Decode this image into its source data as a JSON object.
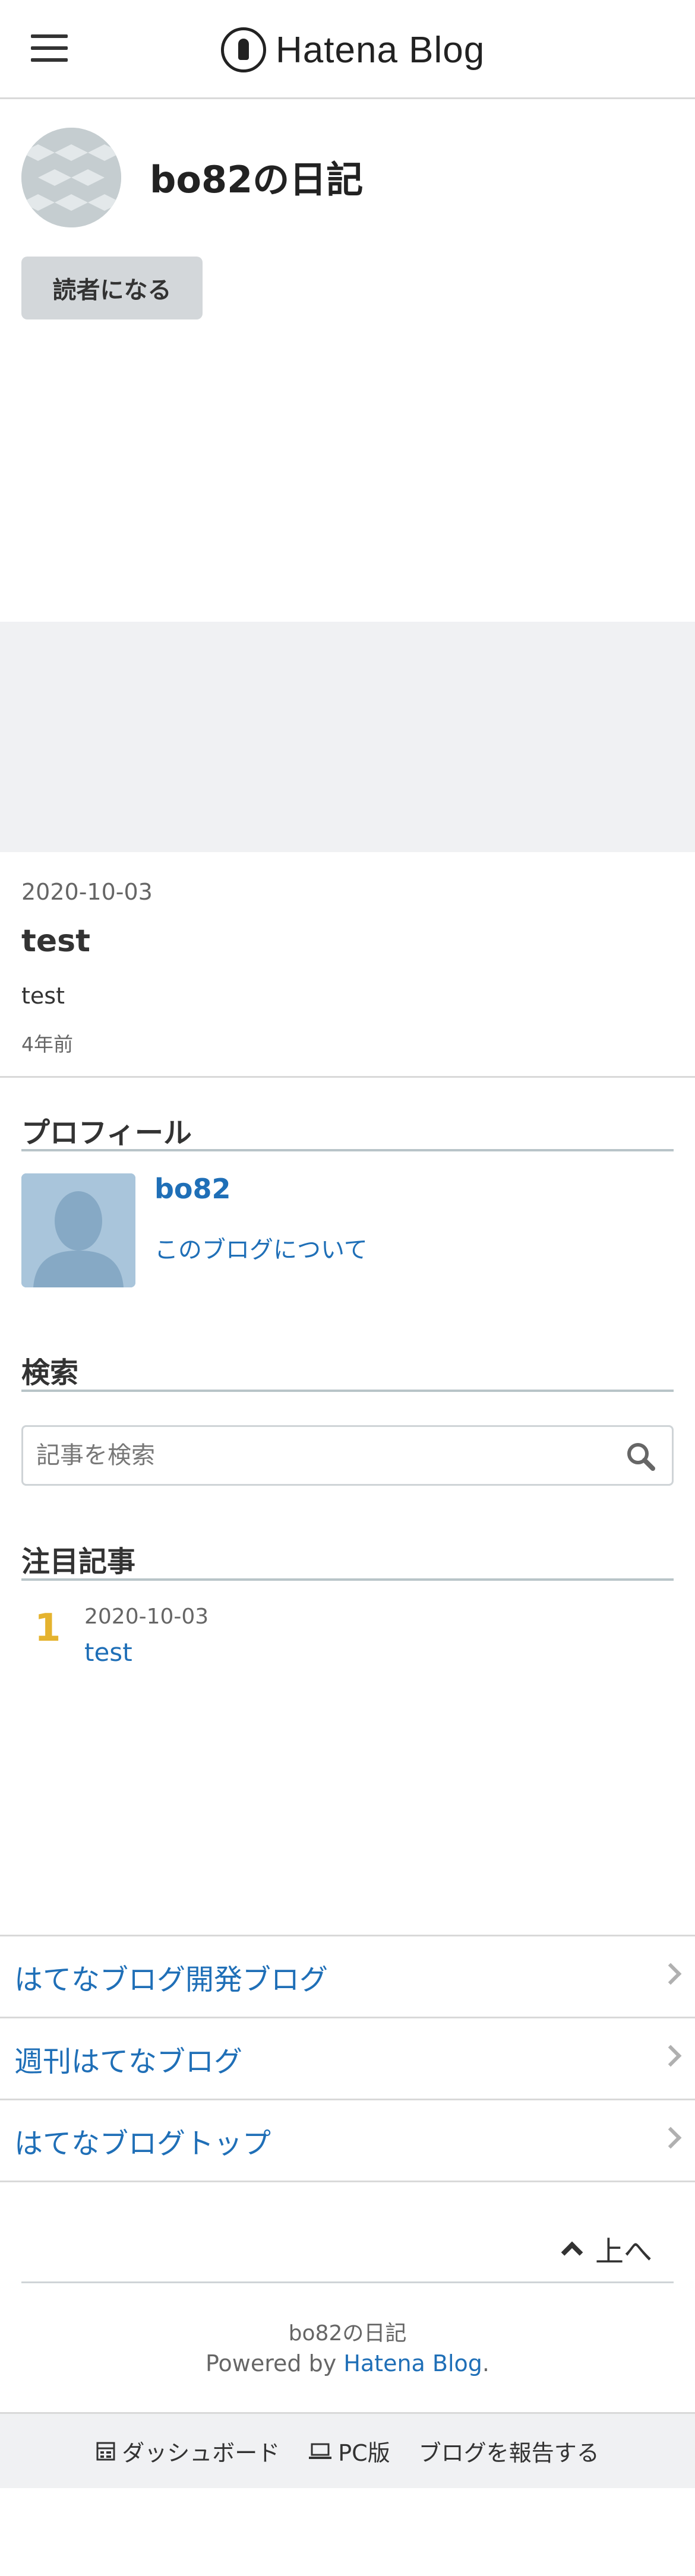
{
  "header": {
    "logo_text": "Hatena Blog",
    "menu_icon": "hamburger-menu-icon"
  },
  "blog": {
    "title": "bo82の日記",
    "subscribe_label": "読者になる"
  },
  "entry": {
    "date": "2020-10-03",
    "title": "test",
    "body": "test",
    "ago": "4年前"
  },
  "profile": {
    "heading": "プロフィール",
    "name": "bo82",
    "about_link": "このブログについて"
  },
  "search": {
    "heading": "検索",
    "placeholder": "記事を検索",
    "icon": "search-icon"
  },
  "featured": {
    "heading": "注目記事",
    "items": [
      {
        "rank": "1",
        "date": "2020-10-03",
        "title": "test"
      }
    ]
  },
  "footer_links": [
    "はてなブログ開発ブログ",
    "週刊はてなブログ",
    "はてなブログトップ"
  ],
  "back_to_top": "上へ",
  "credit": {
    "blog_name": "bo82の日記",
    "powered_prefix": "Powered by ",
    "powered_link": "Hatena Blog",
    "powered_suffix": "."
  },
  "bottom_bar": {
    "dashboard": "ダッシュボード",
    "pc_version": "PC版",
    "report": "ブログを報告する"
  },
  "colors": {
    "link": "#1f6fb7",
    "rank": "#e5b32e",
    "band": "#f0f1f3"
  }
}
